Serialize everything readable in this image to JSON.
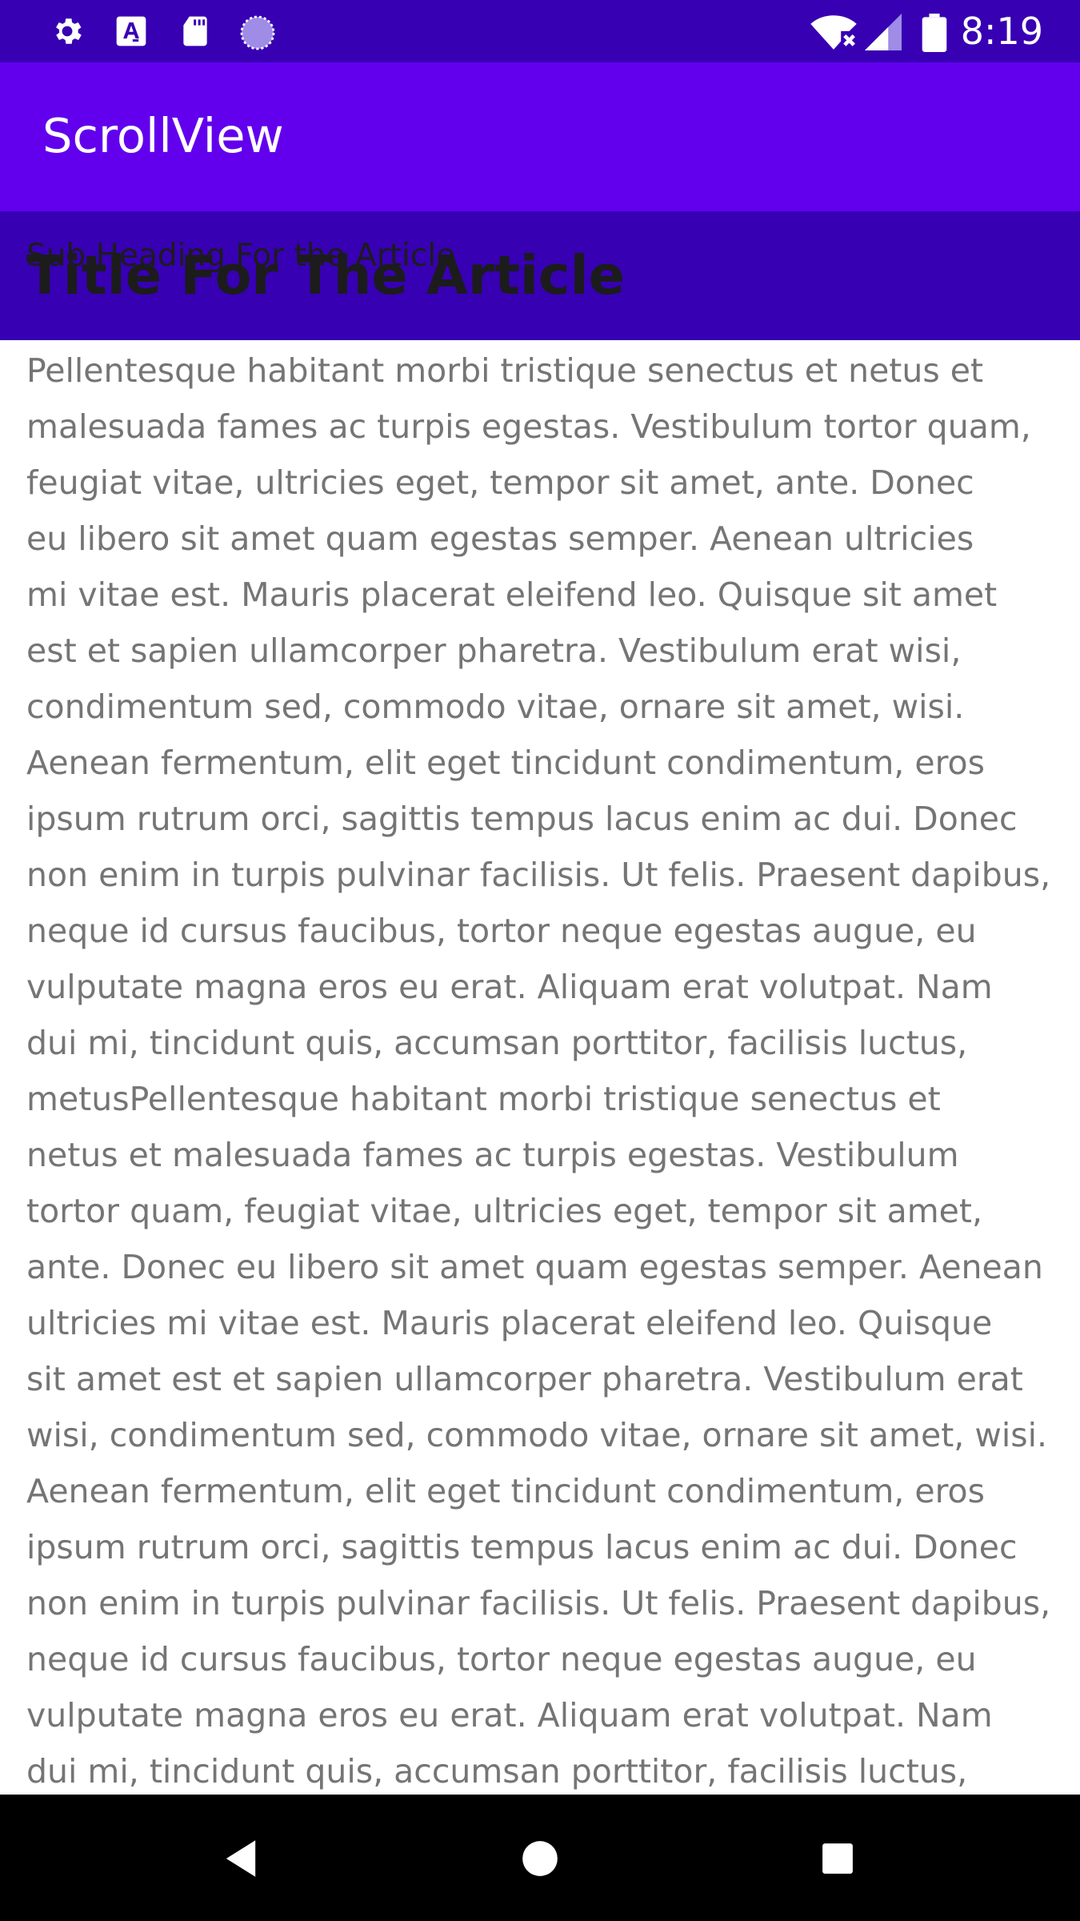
{
  "status_bar": {
    "time": "8:19",
    "left_icons": [
      "gear-icon",
      "accessibility-a-icon",
      "sd-card-icon",
      "sync-circle-icon"
    ],
    "right_icons": [
      "wifi-off-icon",
      "signal-icon",
      "battery-icon"
    ],
    "background": "#3700b3"
  },
  "app_bar": {
    "title": "ScrollView",
    "background": "#6200ee"
  },
  "header": {
    "sub_heading": "Sub Heading For the Article",
    "title": "Title For The Article",
    "background": "#3700b3"
  },
  "article": {
    "lines": [
      "Pellentesque habitant morbi tristique senectus et netus et",
      "malesuada fames ac turpis egestas. Vestibulum tortor quam,",
      "feugiat vitae, ultricies eget, tempor sit amet, ante. Donec",
      "eu libero sit amet quam egestas semper. Aenean ultricies",
      "mi vitae est. Mauris placerat eleifend leo. Quisque sit amet",
      "est et sapien ullamcorper pharetra. Vestibulum erat wisi,",
      "condimentum sed, commodo vitae, ornare sit amet, wisi.",
      "Aenean fermentum, elit eget tincidunt condimentum, eros",
      "ipsum rutrum orci, sagittis tempus lacus enim ac dui. Donec",
      "non enim in turpis pulvinar facilisis. Ut felis. Praesent dapibus,",
      "neque id cursus faucibus, tortor neque egestas augue, eu",
      "vulputate magna eros eu erat. Aliquam erat volutpat. Nam",
      "dui mi, tincidunt quis, accumsan porttitor, facilisis luctus,",
      "metusPellentesque habitant morbi tristique senectus et",
      "netus et malesuada fames ac turpis egestas. Vestibulum",
      "tortor quam, feugiat vitae, ultricies eget, tempor sit amet,",
      "ante. Donec eu libero sit amet quam egestas semper. Aenean",
      "ultricies mi vitae est. Mauris placerat eleifend leo. Quisque",
      "sit amet est et sapien ullamcorper pharetra. Vestibulum erat",
      "wisi, condimentum sed, commodo vitae, ornare sit amet, wisi.",
      "Aenean fermentum, elit eget tincidunt condimentum, eros",
      "ipsum rutrum orci, sagittis tempus lacus enim ac dui. Donec",
      "non enim in turpis pulvinar facilisis. Ut felis. Praesent dapibus,",
      "neque id cursus faucibus, tortor neque egestas augue, eu",
      "vulputate magna eros eu erat. Aliquam erat volutpat. Nam",
      "dui mi, tincidunt quis, accumsan porttitor, facilisis luctus,"
    ],
    "text_color": "#757575"
  },
  "nav_bar": {
    "buttons": [
      "back-icon",
      "home-icon",
      "recents-icon"
    ],
    "background": "#000000"
  }
}
